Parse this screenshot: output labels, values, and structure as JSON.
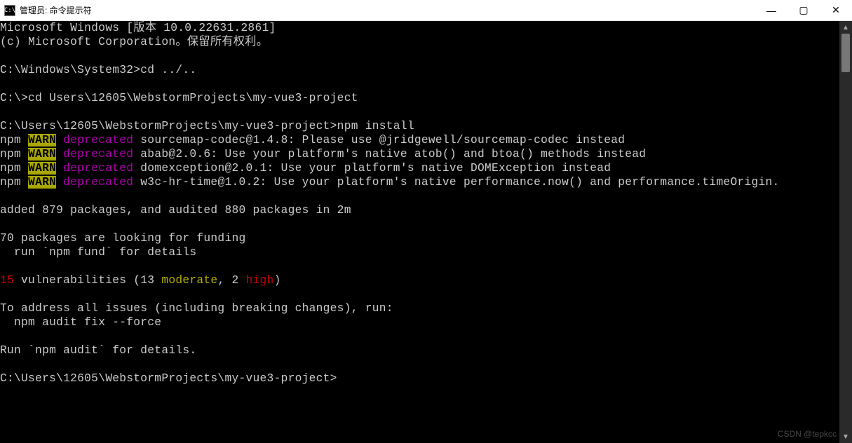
{
  "window": {
    "icon_text": "C:\\",
    "title": "管理员: 命令提示符",
    "minimize": "—",
    "maximize": "▢",
    "close": "✕"
  },
  "lines": {
    "l1": "Microsoft Windows [版本 10.0.22631.2861]",
    "l2": "(c) Microsoft Corporation。保留所有权利。",
    "l3": "C:\\Windows\\System32>cd ../..",
    "l4": "C:\\>cd Users\\12605\\WebstormProjects\\my-vue3-project",
    "l5": "C:\\Users\\12605\\WebstormProjects\\my-vue3-project>npm install",
    "warn_npm": "npm ",
    "warn_tag": "WARN",
    "warn_dep": " deprecated",
    "warn1_msg": " sourcemap-codec@1.4.8: Please use @jridgewell/sourcemap-codec instead",
    "warn2_msg": " abab@2.0.6: Use your platform's native atob() and btoa() methods instead",
    "warn3_msg": " domexception@2.0.1: Use your platform's native DOMException instead",
    "warn4_msg": " w3c-hr-time@1.0.2: Use your platform's native performance.now() and performance.timeOrigin.",
    "l7": "added 879 packages, and audited 880 packages in 2m",
    "l8": "70 packages are looking for funding",
    "l9": "  run `npm fund` for details",
    "vuln_count": "15",
    "vuln_text1": " vulnerabilities (13 ",
    "vuln_mod": "moderate",
    "vuln_text2": ", 2 ",
    "vuln_high": "high",
    "vuln_text3": ")",
    "l11": "To address all issues (including breaking changes), run:",
    "l12": "  npm audit fix --force",
    "l13": "Run `npm audit` for details.",
    "l14": "C:\\Users\\12605\\WebstormProjects\\my-vue3-project>"
  },
  "watermark": "CSDN @tepkcc"
}
